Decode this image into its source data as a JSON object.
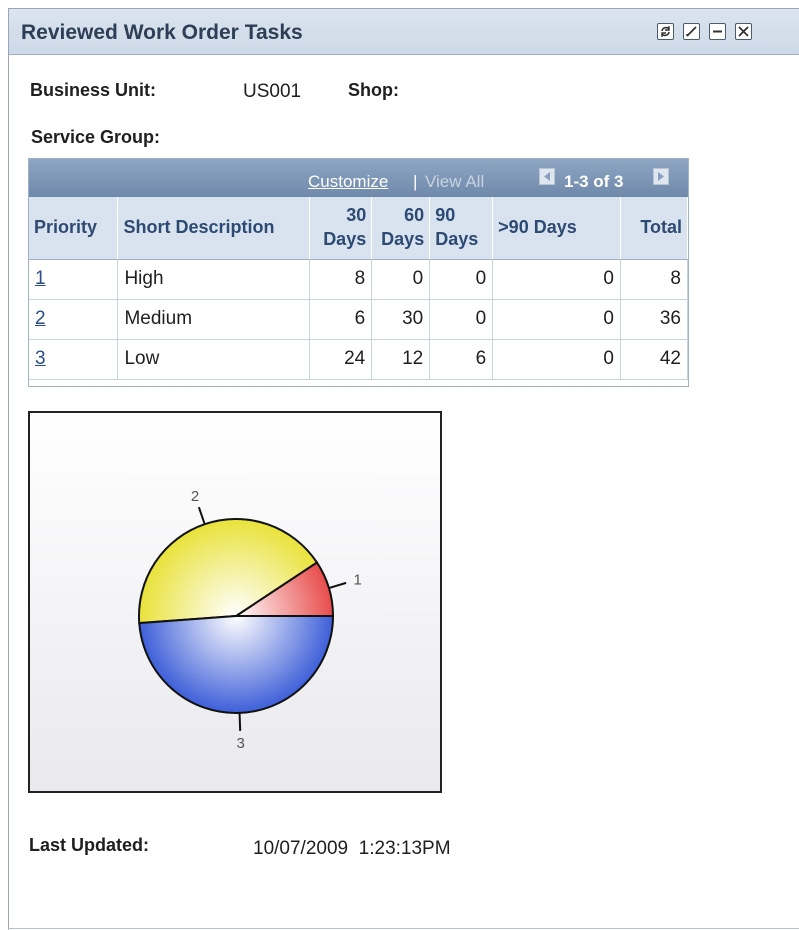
{
  "pagelet": {
    "title": "Reviewed Work Order Tasks",
    "buttons": [
      "refresh-icon",
      "edit-icon",
      "minimize-icon",
      "close-icon"
    ]
  },
  "fields": {
    "business_unit_label": "Business Unit:",
    "business_unit_value": "US001",
    "shop_label": "Shop:",
    "service_group_label": "Service Group:"
  },
  "grid": {
    "nav": {
      "customize": "Customize",
      "separator": "|",
      "view_all": "View All",
      "range": "1-3 of 3"
    },
    "headers": [
      "Priority",
      "Short Description",
      "30 Days",
      "60 Days",
      "90 Days",
      ">90 Days",
      "Total"
    ],
    "rows": [
      {
        "priority": "1",
        "description": "High",
        "d30": "8",
        "d60": "0",
        "d90": "0",
        "d90plus": "0",
        "total": "8"
      },
      {
        "priority": "2",
        "description": "Medium",
        "d30": "6",
        "d60": "30",
        "d90": "0",
        "d90plus": "0",
        "total": "36"
      },
      {
        "priority": "3",
        "description": "Low",
        "d30": "24",
        "d60": "12",
        "d90": "6",
        "d90plus": "0",
        "total": "42"
      }
    ]
  },
  "chart_data": {
    "type": "pie",
    "categories": [
      "1",
      "2",
      "3"
    ],
    "values": [
      8,
      36,
      42
    ],
    "colors": [
      "#e84c4c",
      "#e9e23a",
      "#3e5fd8"
    ]
  },
  "footer": {
    "last_updated_label": "Last Updated:",
    "last_updated_value": "10/07/2009  1:23:13PM"
  }
}
